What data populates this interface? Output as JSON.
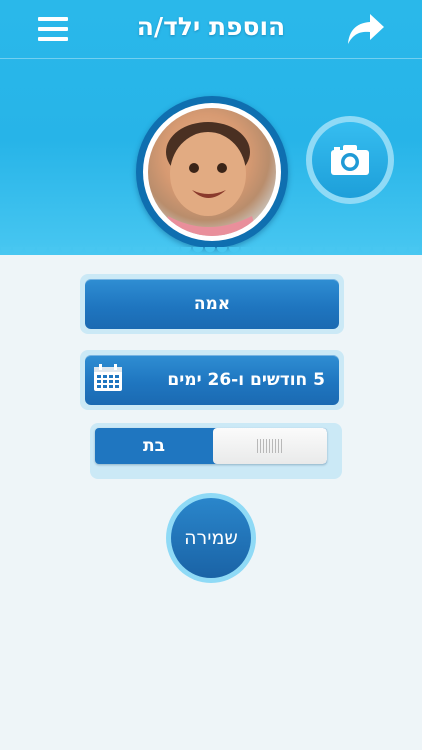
{
  "header": {
    "title": "הוספת ילד/ה",
    "menu_icon": "hamburger-menu-icon",
    "forward_icon": "forward-arrow-icon"
  },
  "photo": {
    "camera_icon": "camera-icon"
  },
  "form": {
    "name_value": "אמה",
    "age_value": "5 חודשים ו-26 ימים",
    "calendar_icon": "calendar-icon",
    "gender_selected": "בת"
  },
  "actions": {
    "save_label": "שמירה"
  },
  "colors": {
    "header": "#27b4e8",
    "button": "#1f76c0",
    "background": "#eef5f8"
  }
}
